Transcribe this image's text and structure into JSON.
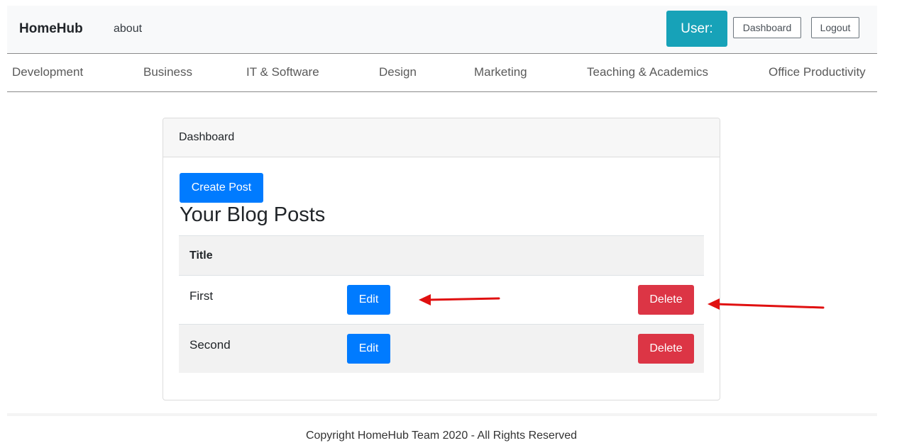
{
  "navbar": {
    "brand": "HomeHub",
    "about": "about",
    "user_label": "User:",
    "dashboard_link": "Dashboard",
    "logout": "Logout"
  },
  "categories": [
    "Development",
    "Business",
    "IT & Software",
    "Design",
    "Marketing",
    "Teaching & Academics",
    "Office Productivity"
  ],
  "card": {
    "header": "Dashboard",
    "create_button": "Create Post",
    "heading": "Your Blog Posts",
    "table": {
      "column_title": "Title",
      "rows": [
        {
          "title": "First",
          "edit": "Edit",
          "delete": "Delete"
        },
        {
          "title": "Second",
          "edit": "Edit",
          "delete": "Delete"
        }
      ]
    }
  },
  "footer": {
    "text": "Copyright HomeHub Team 2020 - All Rights Reserved"
  },
  "colors": {
    "info": "#17a2b8",
    "primary": "#007bff",
    "danger": "#dc3545",
    "annotation_arrow": "#e01010"
  }
}
